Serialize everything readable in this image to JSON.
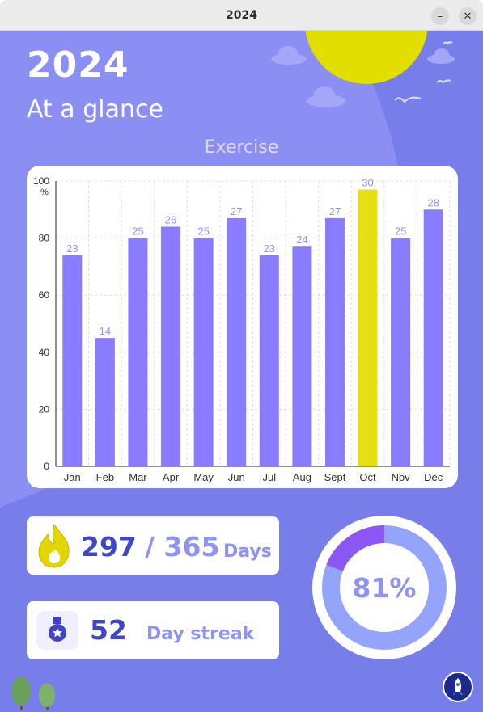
{
  "window": {
    "title": "2024",
    "minimize_glyph": "–",
    "close_glyph": "✕"
  },
  "header": {
    "year": "2024",
    "subtitle": "At a glance",
    "section": "Exercise"
  },
  "colors": {
    "background": "#8b8ff3",
    "bar": "#8a7cff",
    "highlight_bar": "#e5e012",
    "accent": "#4146c9",
    "sun": "#e2de00"
  },
  "chart_data": {
    "type": "bar",
    "categories": [
      "Jan",
      "Feb",
      "Mar",
      "Apr",
      "May",
      "Jun",
      "Jul",
      "Aug",
      "Sept",
      "Oct",
      "Nov",
      "Dec"
    ],
    "values": [
      74,
      45,
      80,
      84,
      80,
      87,
      74,
      77,
      87,
      97,
      80,
      90
    ],
    "data_labels": [
      "23",
      "14",
      "25",
      "26",
      "25",
      "27",
      "23",
      "24",
      "27",
      "30",
      "25",
      "28"
    ],
    "highlight": "Oct",
    "ylabel": "%",
    "yticks": [
      "0",
      "20",
      "40",
      "60",
      "80",
      "100"
    ],
    "ylim": [
      0,
      100
    ],
    "grid": true
  },
  "stats": {
    "days_done": "297",
    "days_total": "/ 365",
    "days_unit": "Days",
    "streak": "52",
    "streak_unit": "Day streak",
    "percent_label": "81%",
    "percent": 81
  },
  "icons": {
    "days": "flame-icon",
    "streak": "medal-icon",
    "app": "rocket-badge-icon"
  }
}
